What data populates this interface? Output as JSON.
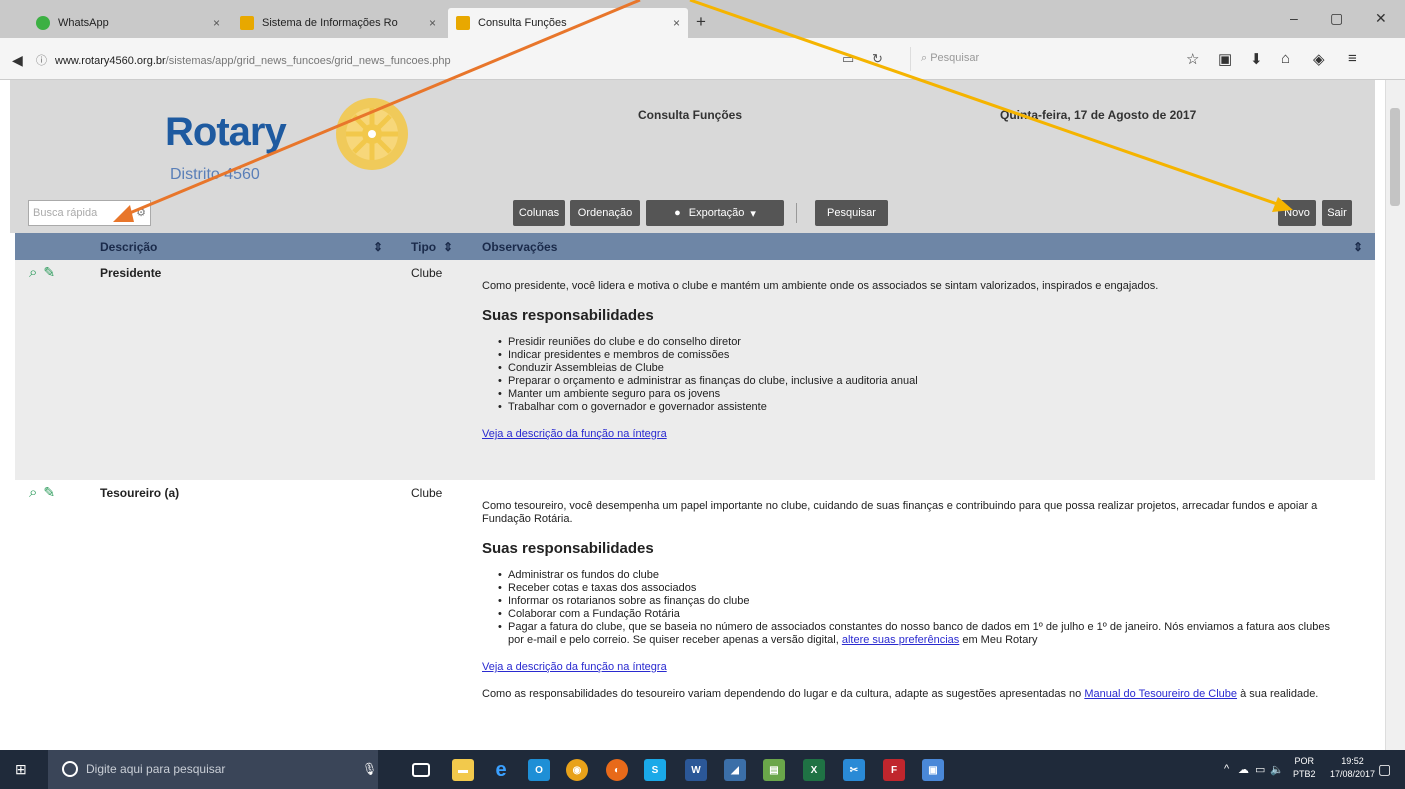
{
  "browser": {
    "tabs": [
      {
        "label": "WhatsApp",
        "close": "×"
      },
      {
        "label": "Sistema de Informações Ro",
        "close": "×"
      },
      {
        "label": "Consulta Funções",
        "close": "×"
      }
    ],
    "new_tab": "+",
    "window_controls": {
      "minimize": "–",
      "maximize": "▢",
      "close": "✕"
    },
    "url_host": "www.rotary4560.org.br",
    "url_path": "/sistemas/app/grid_news_funcoes/grid_news_funcoes.php",
    "search_placeholder": "Pesquisar"
  },
  "page": {
    "logo_word": "Rotary",
    "logo_district": "Distrito 4560",
    "title": "Consulta Funções",
    "date": "Quinta-feira, 17 de Agosto de 2017"
  },
  "toolbar": {
    "quick_search_placeholder": "Busca rápida",
    "colunas": "Colunas",
    "ordenacao": "Ordenação",
    "exportacao": "Exportação",
    "pesquisar": "Pesquisar",
    "novo": "Novo",
    "sair": "Sair"
  },
  "grid": {
    "columns": {
      "descricao": "Descrição",
      "tipo": "Tipo",
      "observacoes": "Observações"
    },
    "rows": [
      {
        "descricao": "Presidente",
        "tipo": "Clube",
        "intro": "Como presidente, você lidera e motiva o clube e mantém um ambiente onde os associados se sintam valorizados, inspirados e engajados.",
        "heading": "Suas responsabilidades",
        "items": [
          "Presidir reuniões do clube e do conselho diretor",
          "Indicar presidentes e membros de comissões",
          "Conduzir Assembleias de Clube",
          "Preparar o orçamento e administrar as finanças do clube, inclusive a auditoria anual",
          "Manter um ambiente seguro para os jovens",
          "Trabalhar com o governador e governador assistente"
        ],
        "link": "Veja a descrição da função na íntegra"
      },
      {
        "descricao": "Tesoureiro (a)",
        "tipo": "Clube",
        "intro": "Como tesoureiro, você desempenha um papel importante no clube, cuidando de suas finanças e contribuindo para que possa realizar projetos, arrecadar fundos e apoiar a Fundação Rotária.",
        "heading": "Suas responsabilidades",
        "items": [
          "Administrar os fundos do clube",
          "Receber cotas e taxas dos associados",
          "Informar os rotarianos sobre as finanças do clube",
          "Colaborar com a Fundação Rotária"
        ],
        "last_item_pre": "Pagar a fatura do clube, que se baseia no número de associados constantes do nosso banco de dados em 1º de julho e 1º de janeiro. Nós enviamos a fatura aos clubes por e-mail e pelo correio. Se quiser receber apenas a versão digital, ",
        "last_item_link": "altere suas preferências",
        "last_item_post": " em Meu Rotary",
        "link": "Veja a descrição da função na íntegra",
        "note_pre": "Como as responsabilidades do tesoureiro variam dependendo do lugar e da cultura, adapte as sugestões apresentadas no ",
        "note_link": "Manual do Tesoureiro de Clube",
        "note_post": " à sua realidade."
      }
    ]
  },
  "taskbar": {
    "search_placeholder": "Digite aqui para pesquisar",
    "lang_top": "POR",
    "lang_bottom": "PTB2",
    "time": "19:52",
    "date": "17/08/2017"
  },
  "colors": {
    "header_bg": "#d9d9d9",
    "grid_header": "#6e86a6",
    "button_dark": "#555555",
    "rotary_blue": "#1e5aa0",
    "rotary_gold": "#f2b51c",
    "arrow_orange": "#e8762b",
    "arrow_yellow": "#f5b400"
  }
}
